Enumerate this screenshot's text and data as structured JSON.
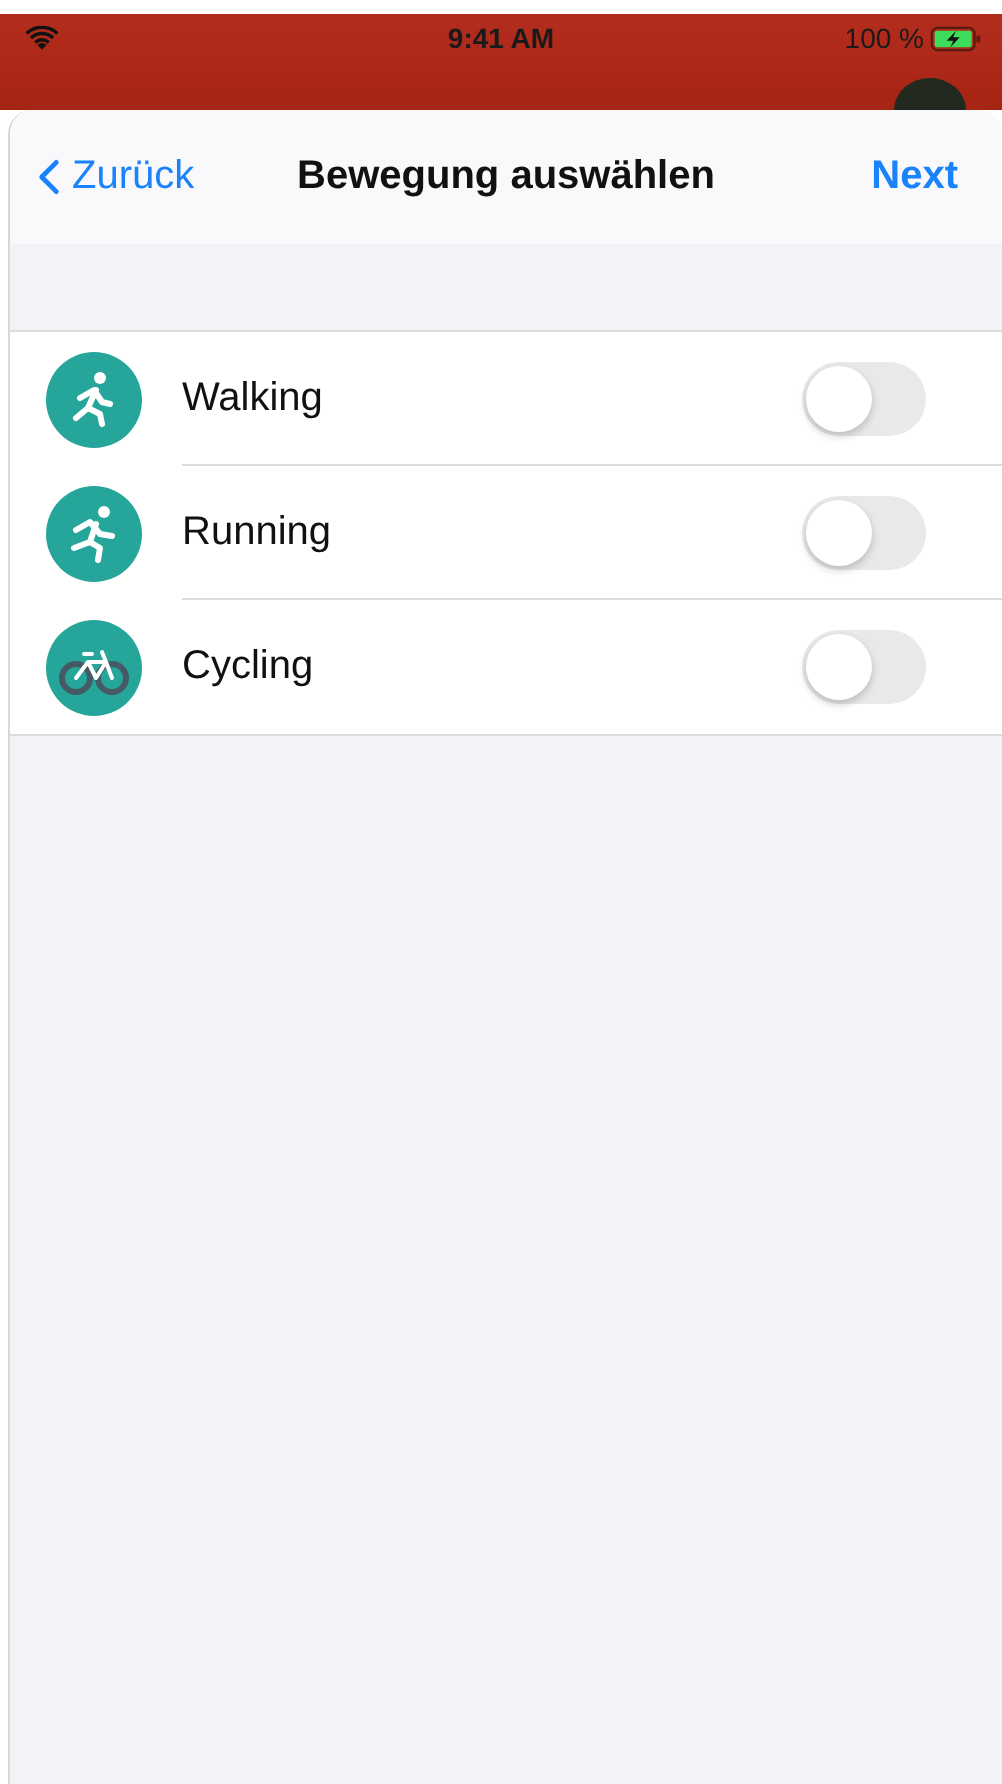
{
  "status_bar": {
    "time": "9:41 AM",
    "battery": "100 %"
  },
  "nav": {
    "back": "Zurück",
    "title": "Bewegung auswählen",
    "next": "Next"
  },
  "activities": [
    {
      "kind": "walking",
      "label": "Walking",
      "on": false
    },
    {
      "kind": "running",
      "label": "Running",
      "on": false
    },
    {
      "kind": "cycling",
      "label": "Cycling",
      "on": false
    }
  ]
}
